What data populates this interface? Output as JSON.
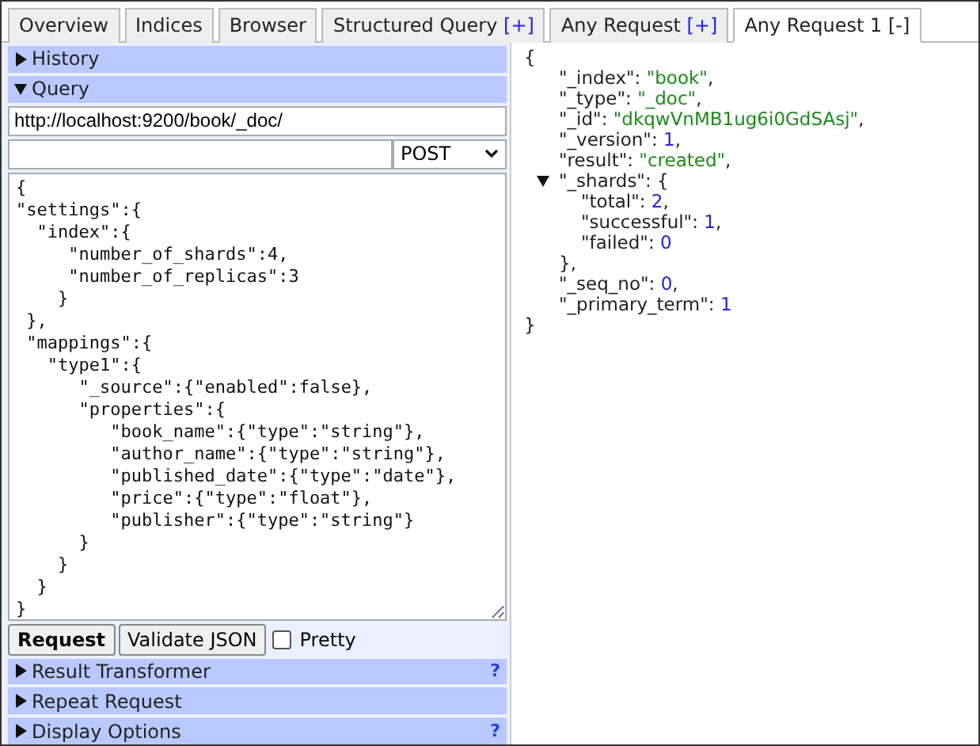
{
  "tabs": [
    {
      "label": "Overview",
      "selected": false
    },
    {
      "label": "Indices",
      "selected": false
    },
    {
      "label": "Browser",
      "selected": false
    },
    {
      "label": "Structured Query",
      "action": "[+]",
      "selected": false
    },
    {
      "label": "Any Request",
      "action": "[+]",
      "selected": false
    },
    {
      "label": "Any Request 1",
      "action": "[-]",
      "selected": true
    }
  ],
  "sections": [
    {
      "label": "History",
      "expanded": false
    },
    {
      "label": "Query",
      "expanded": true,
      "query": {
        "url": "http://localhost:9200/book/_doc/",
        "method": "POST",
        "body": "{\n\"settings\":{\n  \"index\":{\n     \"number_of_shards\":4,\n     \"number_of_replicas\":3\n    }\n },\n \"mappings\":{\n   \"type1\":{\n      \"_source\":{\"enabled\":false},\n      \"properties\":{\n         \"book_name\":{\"type\":\"string\"},\n         \"author_name\":{\"type\":\"string\"},\n         \"published_date\":{\"type\":\"date\"},\n         \"price\":{\"type\":\"float\"},\n         \"publisher\":{\"type\":\"string\"}\n      }\n    }\n  }\n}",
        "buttons": [
          {
            "label": "Request",
            "primary": true
          },
          {
            "label": "Validate JSON",
            "primary": false
          }
        ],
        "pretty": {
          "label": "Pretty",
          "checked": false
        }
      }
    },
    {
      "label": "Result Transformer",
      "expanded": false,
      "help": "?"
    },
    {
      "label": "Repeat Request",
      "expanded": false
    },
    {
      "label": "Display Options",
      "expanded": false,
      "help": "?"
    }
  ],
  "result": {
    "open": "{",
    "close": "}",
    "entries": [
      {
        "key": "\"_index\": ",
        "value": "\"book\"",
        "kind": "string",
        "tail": ","
      },
      {
        "key": "\"_type\": ",
        "value": "\"_doc\"",
        "kind": "string",
        "tail": ","
      },
      {
        "key": "\"_id\": ",
        "value": "\"dkqwVnMB1ug6i0GdSAsj\"",
        "kind": "string",
        "tail": ","
      },
      {
        "key": "\"_version\": ",
        "value": "1",
        "kind": "number",
        "tail": ","
      },
      {
        "key": "\"result\": ",
        "value": "\"created\"",
        "kind": "string",
        "tail": ","
      },
      {
        "key": "\"_shards\": ",
        "value": "{",
        "kind": "object",
        "expanded": true,
        "close": "},",
        "children": [
          {
            "key": "\"total\": ",
            "value": "2",
            "kind": "number",
            "tail": ","
          },
          {
            "key": "\"successful\": ",
            "value": "1",
            "kind": "number",
            "tail": ","
          },
          {
            "key": "\"failed\": ",
            "value": "0",
            "kind": "number"
          }
        ]
      },
      {
        "key": "\"_seq_no\": ",
        "value": "0",
        "kind": "number",
        "tail": ","
      },
      {
        "key": "\"_primary_term\": ",
        "value": "1",
        "kind": "number"
      }
    ]
  }
}
